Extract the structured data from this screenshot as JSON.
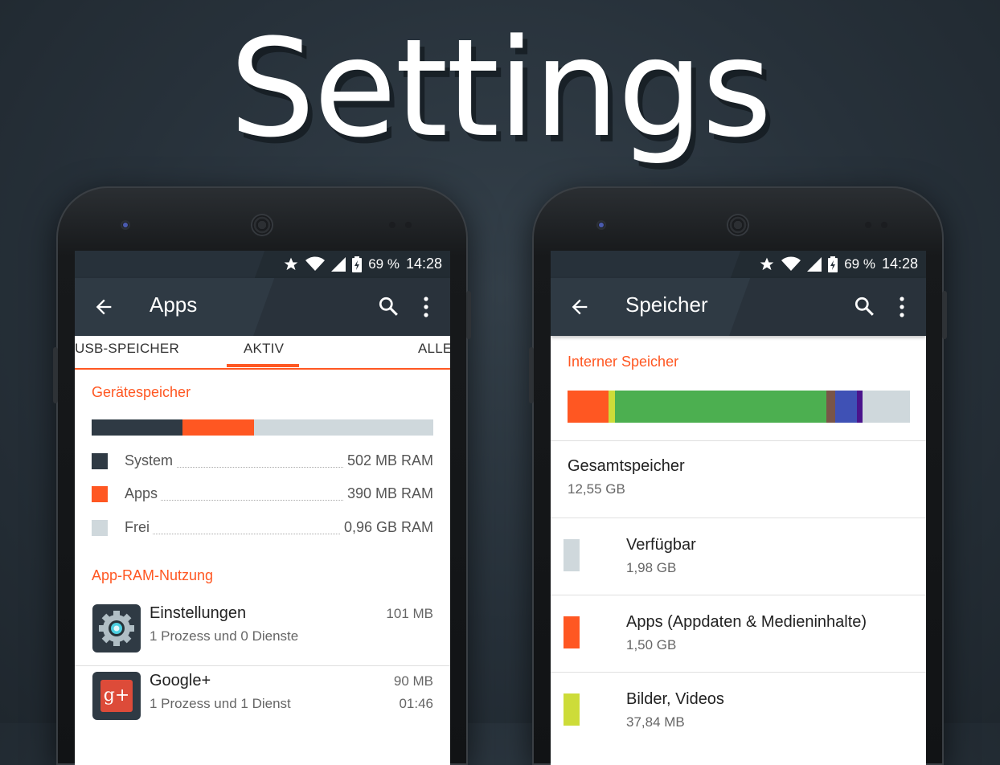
{
  "hero": {
    "title": "Settings"
  },
  "colors": {
    "accent": "#ff5722",
    "system": "#2f3a44",
    "apps": "#ff5722",
    "free": "#cfd8dc",
    "green": "#4caf50",
    "yellow": "#cddc39",
    "brown": "#795548",
    "indigo": "#3f51b5",
    "purple": "#4a148c"
  },
  "status": {
    "battery": "69 %",
    "time": "14:28",
    "icons": [
      "star-icon",
      "wifi-icon",
      "signal-icon",
      "battery-icon"
    ]
  },
  "left": {
    "title": "Apps",
    "tabs": [
      "USB-SPEICHER",
      "AKTIV",
      "ALLE"
    ],
    "device_memory_header": "Gerätespeicher",
    "memory_bar_fractions": {
      "system": 0.267,
      "apps": 0.208,
      "free": 0.525
    },
    "legend": [
      {
        "label": "System",
        "value": "502 MB RAM"
      },
      {
        "label": "Apps",
        "value": "390 MB RAM"
      },
      {
        "label": "Frei",
        "value": "0,96 GB RAM"
      }
    ],
    "ram_usage_header": "App-RAM-Nutzung",
    "apps": [
      {
        "name": "Einstellungen",
        "detail": "1 Prozess und 0 Dienste",
        "size": "101 MB",
        "time": "",
        "icon": "settings-gear-icon"
      },
      {
        "name": "Google+",
        "detail": "1 Prozess und 1 Dienst",
        "size": "90 MB",
        "time": "01:46",
        "icon": "google-plus-icon",
        "icon_label": "g+"
      }
    ]
  },
  "right": {
    "title": "Speicher",
    "internal_header": "Interner Speicher",
    "storage_bar_fractions": [
      {
        "name": "Apps",
        "fraction": 0.12
      },
      {
        "name": "Bilder, Videos",
        "fraction": 0.018
      },
      {
        "name": "green",
        "fraction": 0.618
      },
      {
        "name": "brown",
        "fraction": 0.026
      },
      {
        "name": "indigo",
        "fraction": 0.062
      },
      {
        "name": "purple",
        "fraction": 0.018
      },
      {
        "name": "Verfügbar",
        "fraction": 0.138
      }
    ],
    "total": {
      "label": "Gesamtspeicher",
      "value": "12,55 GB"
    },
    "items": [
      {
        "label": "Verfügbar",
        "value": "1,98 GB"
      },
      {
        "label": "Apps (Appdaten & Medieninhalte)",
        "value": "1,50 GB"
      },
      {
        "label": "Bilder, Videos",
        "value": "37,84 MB"
      }
    ]
  }
}
